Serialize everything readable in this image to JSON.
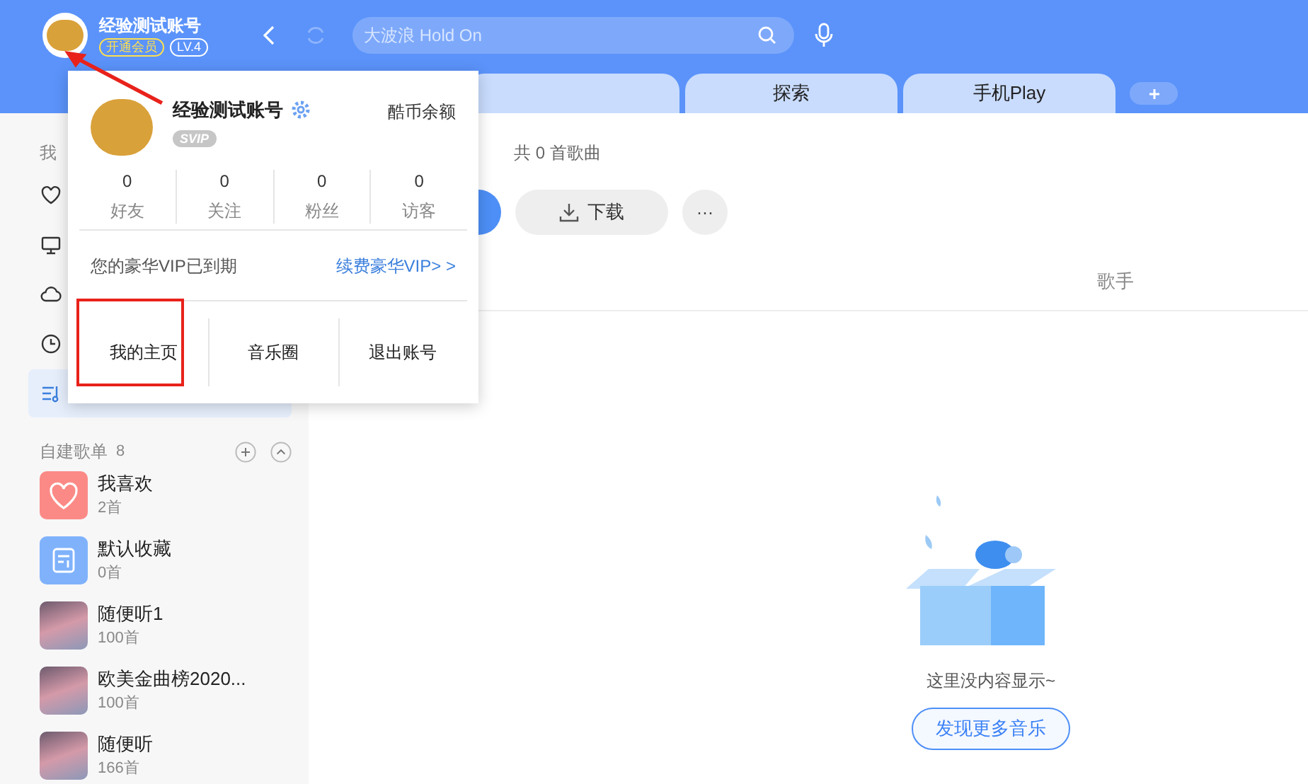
{
  "header": {
    "account_name": "经验测试账号",
    "vip_badge": "开通会员",
    "level_badge": "LV.4",
    "search": {
      "placeholder": "大波浪 Hold On"
    }
  },
  "tabs": [
    {
      "label": "探索",
      "selected": false
    },
    {
      "label": "手机Play",
      "selected": false
    }
  ],
  "sidebar": {
    "section_label": "我",
    "nav_items": [
      {
        "kind": "heart",
        "selected": false
      },
      {
        "kind": "monitor",
        "selected": false
      },
      {
        "kind": "cloud",
        "selected": false
      },
      {
        "kind": "clock",
        "selected": false
      },
      {
        "kind": "playlist",
        "selected": true
      }
    ],
    "playlists_header": {
      "label": "自建歌单",
      "count": "8"
    },
    "playlists": [
      {
        "kind": "heart",
        "name": "我喜欢",
        "count": "2首"
      },
      {
        "kind": "note",
        "name": "默认收藏",
        "count": "0首"
      },
      {
        "kind": "photo",
        "name": "随便听1",
        "count": "100首"
      },
      {
        "kind": "photo",
        "name": "欧美金曲榜2020...",
        "count": "100首"
      },
      {
        "kind": "photo",
        "name": "随便听",
        "count": "166首"
      }
    ]
  },
  "main": {
    "song_count": "共 0 首歌曲",
    "download_button": "下载",
    "more_button": "···",
    "column_header": "歌手",
    "empty_text": "这里没内容显示~",
    "discover_button": "发现更多音乐"
  },
  "popup": {
    "name": "经验测试账号",
    "vip_tag": "SVIP",
    "balance_link": "酷币余额",
    "stats": [
      {
        "value": "0",
        "label": "好友"
      },
      {
        "value": "0",
        "label": "关注"
      },
      {
        "value": "0",
        "label": "粉丝"
      },
      {
        "value": "0",
        "label": "访客"
      }
    ],
    "vip_status": "您的豪华VIP已到期",
    "renew_link": "续费豪华VIP> >",
    "actions": [
      {
        "label": "我的主页",
        "highlighted": true
      },
      {
        "label": "音乐圈",
        "highlighted": false
      },
      {
        "label": "退出账号",
        "highlighted": false
      }
    ]
  }
}
